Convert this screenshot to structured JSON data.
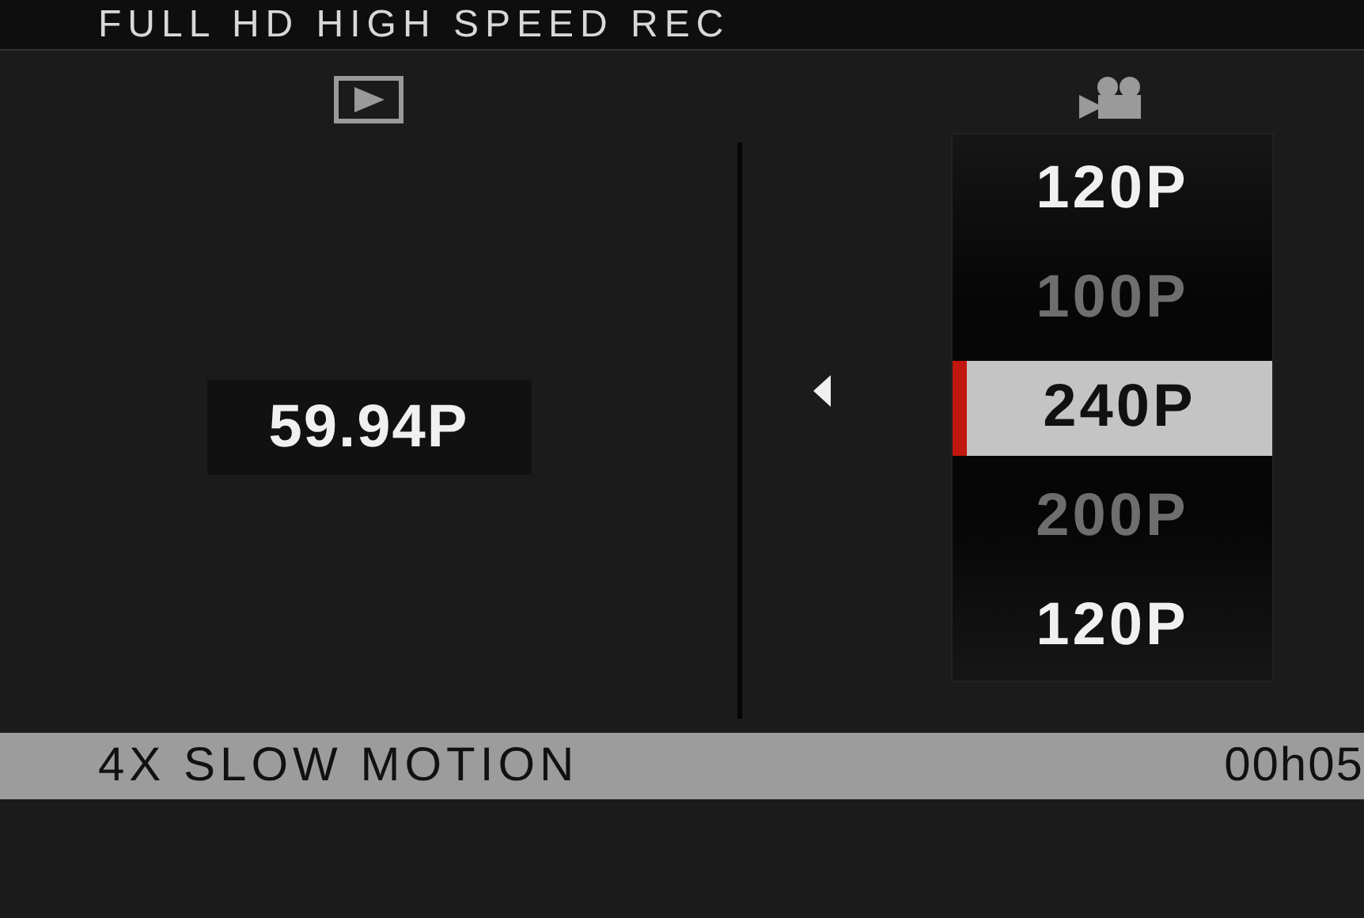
{
  "header": {
    "title": "FULL HD HIGH SPEED REC"
  },
  "current": {
    "value": "59.94P"
  },
  "frame_rates": [
    {
      "label": "120P",
      "selected": false,
      "disabled": false
    },
    {
      "label": "100P",
      "selected": false,
      "disabled": true
    },
    {
      "label": "240P",
      "selected": true,
      "disabled": false
    },
    {
      "label": "200P",
      "selected": false,
      "disabled": true
    },
    {
      "label": "120P",
      "selected": false,
      "disabled": false
    }
  ],
  "footer": {
    "mode": "4X SLOW MOTION",
    "time": "00h05"
  }
}
